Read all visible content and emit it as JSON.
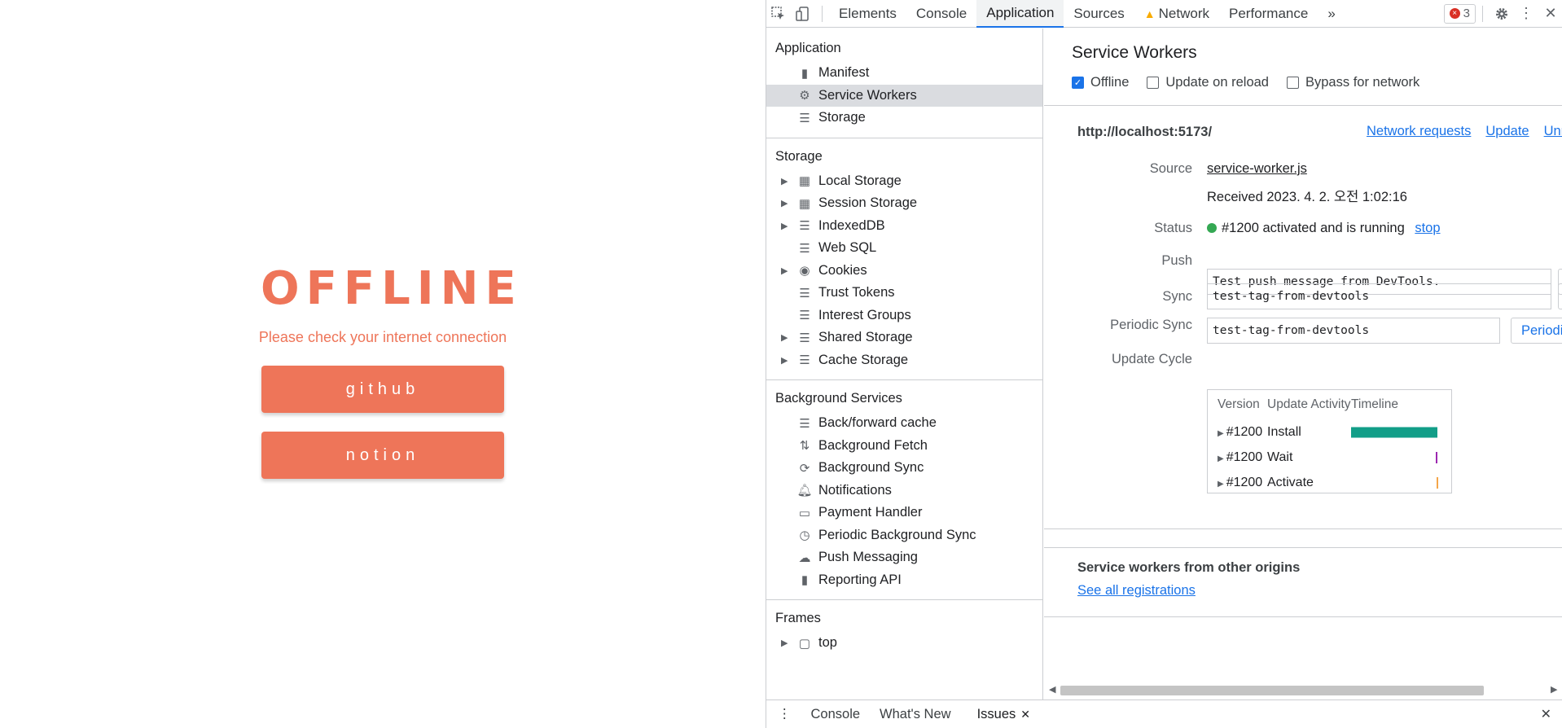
{
  "page": {
    "title": "OFFLINE",
    "subtitle": "Please check your internet connection",
    "buttons": [
      "github",
      "notion"
    ],
    "accent": "#ee7559"
  },
  "devtools": {
    "tabs": [
      "Elements",
      "Console",
      "Application",
      "Sources",
      "Network",
      "Performance"
    ],
    "active_tab": "Application",
    "more": "»",
    "error_count": "3",
    "sidebar": {
      "application": {
        "title": "Application",
        "items": [
          "Manifest",
          "Service Workers",
          "Storage"
        ]
      },
      "storage": {
        "title": "Storage",
        "items": [
          "Local Storage",
          "Session Storage",
          "IndexedDB",
          "Web SQL",
          "Cookies",
          "Trust Tokens",
          "Interest Groups",
          "Shared Storage",
          "Cache Storage"
        ]
      },
      "background": {
        "title": "Background Services",
        "items": [
          "Back/forward cache",
          "Background Fetch",
          "Background Sync",
          "Notifications",
          "Payment Handler",
          "Periodic Background Sync",
          "Push Messaging",
          "Reporting API"
        ]
      },
      "frames": {
        "title": "Frames",
        "items": [
          "top"
        ]
      }
    },
    "panel": {
      "title": "Service Workers",
      "options": [
        "Offline",
        "Update on reload",
        "Bypass for network"
      ],
      "origin": "http://localhost:5173/",
      "actions": [
        "Network requests",
        "Update",
        "Unregister"
      ],
      "labels": {
        "source": "Source",
        "status": "Status",
        "push": "Push",
        "sync": "Sync",
        "periodic": "Periodic Sync",
        "cycle": "Update Cycle"
      },
      "source_link": "service-worker.js",
      "received": "Received 2023. 4. 2. 오전 1:02:16",
      "status_text": "#1200 activated and is running",
      "stop": "stop",
      "push_value": "Test push message from DevTools.",
      "sync_value": "test-tag-from-devtools",
      "periodic_value": "test-tag-from-devtools",
      "periodic_button": "Periodic Sync",
      "cycle": {
        "headers": [
          "Version",
          "Update Activity",
          "Timeline"
        ],
        "rows": [
          {
            "version": "#1200",
            "activity": "Install",
            "color": "#129e88"
          },
          {
            "version": "#1200",
            "activity": "Wait",
            "color": "#9c27b0"
          },
          {
            "version": "#1200",
            "activity": "Activate",
            "color": "#f4a64a"
          }
        ]
      },
      "other_origins": "Service workers from other origins",
      "see_all": "See all registrations"
    },
    "drawer": [
      "Console",
      "What's New",
      "Issues"
    ]
  }
}
